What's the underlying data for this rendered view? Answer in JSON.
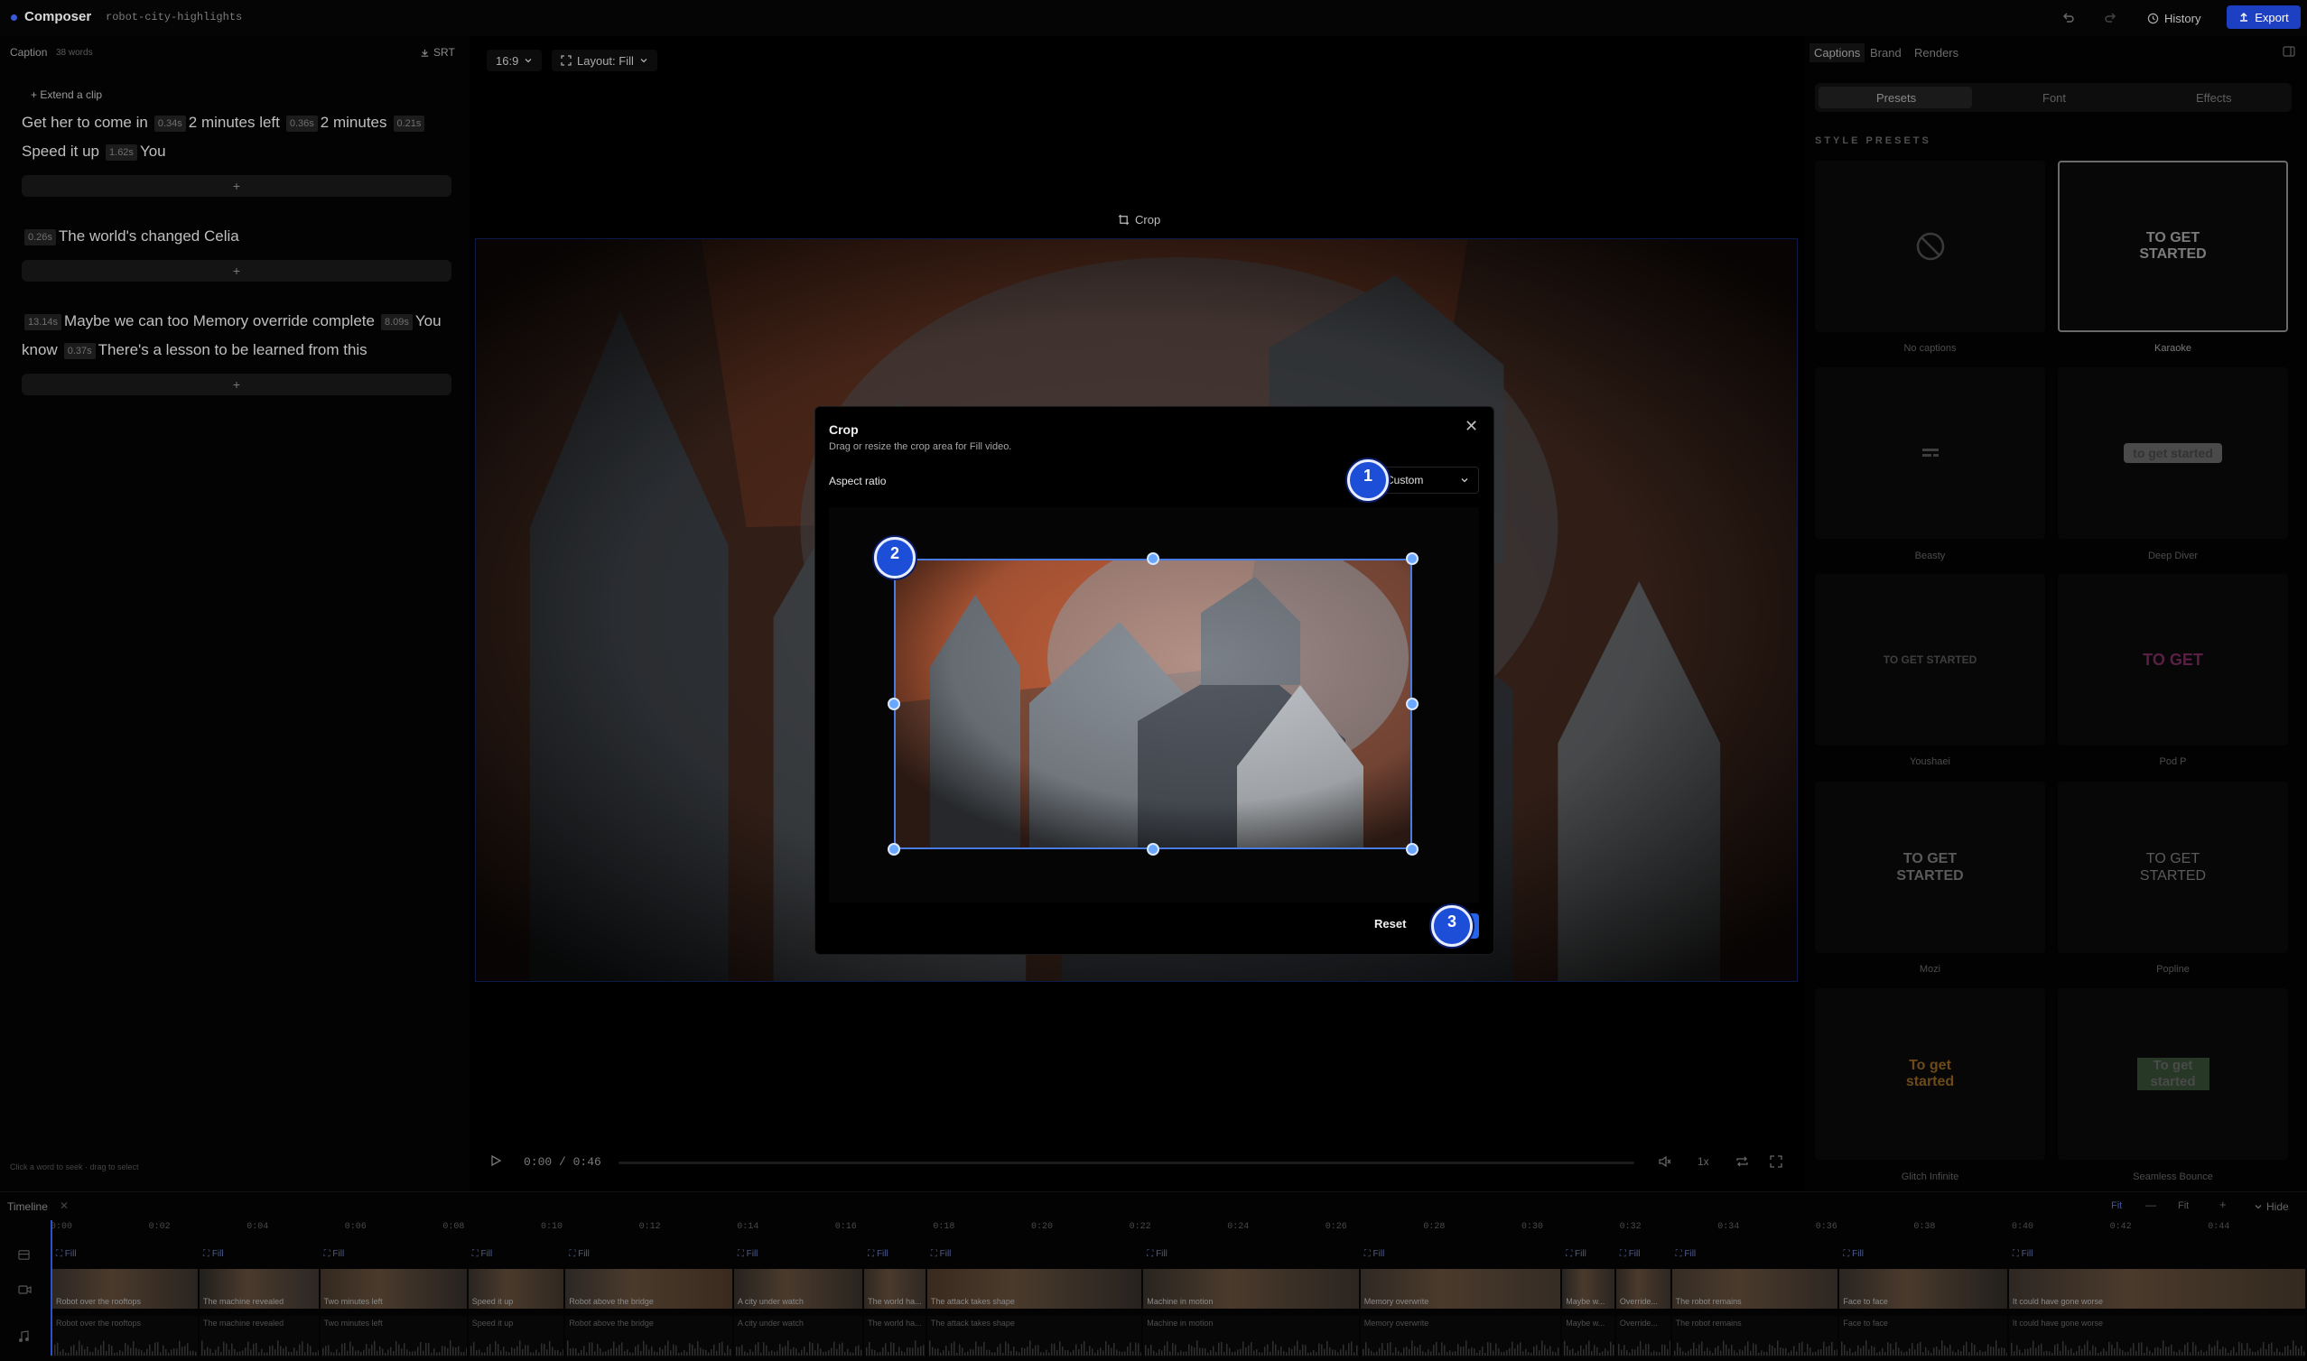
{
  "topbar": {
    "app_title": "Composer",
    "project_name": "robot-city-highlights",
    "history_label": "History",
    "export_label": "Export"
  },
  "left": {
    "caption_label": "Caption",
    "word_count": "38 words",
    "srt_label": "SRT",
    "extend_label": "Extend a clip",
    "add_label": "+",
    "hint": "Click a word to seek · drag to select",
    "clips": [
      {
        "lines": [
          [
            {
              "t": "Get her to come in"
            },
            {
              "ts": "0.34s"
            },
            {
              "t": "2 minutes left"
            },
            {
              "ts": "0.36s"
            },
            {
              "t": "2 minutes"
            },
            {
              "ts": "0.21s"
            }
          ],
          [
            {
              "t": "Speed it up"
            },
            {
              "ts": "1.62s"
            },
            {
              "t": "You"
            }
          ]
        ]
      },
      {
        "lines": [
          [
            {
              "ts": "0.26s"
            },
            {
              "t": "The world's changed Celia"
            }
          ]
        ]
      },
      {
        "lines": [
          [
            {
              "ts": "13.14s"
            },
            {
              "t": "Maybe we can too Memory override complete"
            },
            {
              "ts": "8.09s"
            },
            {
              "t": "You"
            }
          ],
          [
            {
              "t": "know"
            },
            {
              "ts": "0.37s"
            },
            {
              "t": "There's a lesson to be learned from this"
            }
          ]
        ]
      }
    ]
  },
  "center": {
    "aspect_label": "16:9",
    "layout_label": "Layout: Fill",
    "crop_label": "Crop",
    "time_display": "0:00 / 0:46",
    "speed_label": "1x"
  },
  "modal": {
    "title": "Crop",
    "subtitle": "Drag or resize the crop area for Fill video.",
    "aspect_ratio_label": "Aspect ratio",
    "aspect_ratio_value": "Custom",
    "reset_label": "Reset",
    "close_glyph": "✕",
    "badges": [
      "1",
      "2",
      "3"
    ]
  },
  "right": {
    "tabs": [
      "Captions",
      "Brand",
      "Renders"
    ],
    "segments": [
      "Presets",
      "Font",
      "Effects"
    ],
    "section_label": "STYLE PRESETS",
    "presets": [
      {
        "name": "No captions",
        "sample": ""
      },
      {
        "name": "Karaoke",
        "sample": "TO GET STARTED"
      },
      {
        "name": "Beasty",
        "sample": ""
      },
      {
        "name": "Deep Diver",
        "sample": "to get started"
      },
      {
        "name": "Youshaei",
        "sample": "TO GET STARTED"
      },
      {
        "name": "Pod P",
        "sample": "TO GET"
      },
      {
        "name": "Mozi",
        "sample": "TO GET STARTED"
      },
      {
        "name": "Popline",
        "sample": "TO GET STARTED"
      },
      {
        "name": "Glitch Infinite",
        "sample": "To get started"
      },
      {
        "name": "Seamless Bounce",
        "sample": "To get started"
      }
    ]
  },
  "timeline": {
    "label": "Timeline",
    "fit_label": "Fit",
    "fit_value": "Fit",
    "hide_label": "Hide",
    "ticks": [
      "0:00",
      "0:02",
      "0:04",
      "0:06",
      "0:08",
      "0:10",
      "0:12",
      "0:14",
      "0:16",
      "0:18",
      "0:20",
      "0:22",
      "0:24",
      "0:26",
      "0:28",
      "0:30",
      "0:32",
      "0:34",
      "0:36",
      "0:38",
      "0:40",
      "0:42",
      "0:44"
    ],
    "fill_tag": "Fill",
    "clips": [
      {
        "title": "Robot over the rooftops",
        "share": 0.0653
      },
      {
        "title": "The machine revealed",
        "share": 0.0535
      },
      {
        "title": "Two minutes left",
        "share": 0.0657
      },
      {
        "title": "Speed it up",
        "share": 0.0431
      },
      {
        "title": "Robot above the bridge",
        "share": 0.0747
      },
      {
        "title": "A city under watch",
        "share": 0.0578
      },
      {
        "title": "The world ha...",
        "share": 0.0279
      },
      {
        "title": "The attack takes shape",
        "share": 0.0959
      },
      {
        "title": "Machine in motion",
        "share": 0.0963
      },
      {
        "title": "Memory overwrite",
        "share": 0.0895
      },
      {
        "title": "Maybe w...",
        "share": 0.0239
      },
      {
        "title": "Override...",
        "share": 0.0247
      },
      {
        "title": "The robot remains",
        "share": 0.0744
      },
      {
        "title": "Face to face",
        "share": 0.0751
      },
      {
        "title": "It could have gone worse",
        "share": 0.1322
      }
    ]
  }
}
